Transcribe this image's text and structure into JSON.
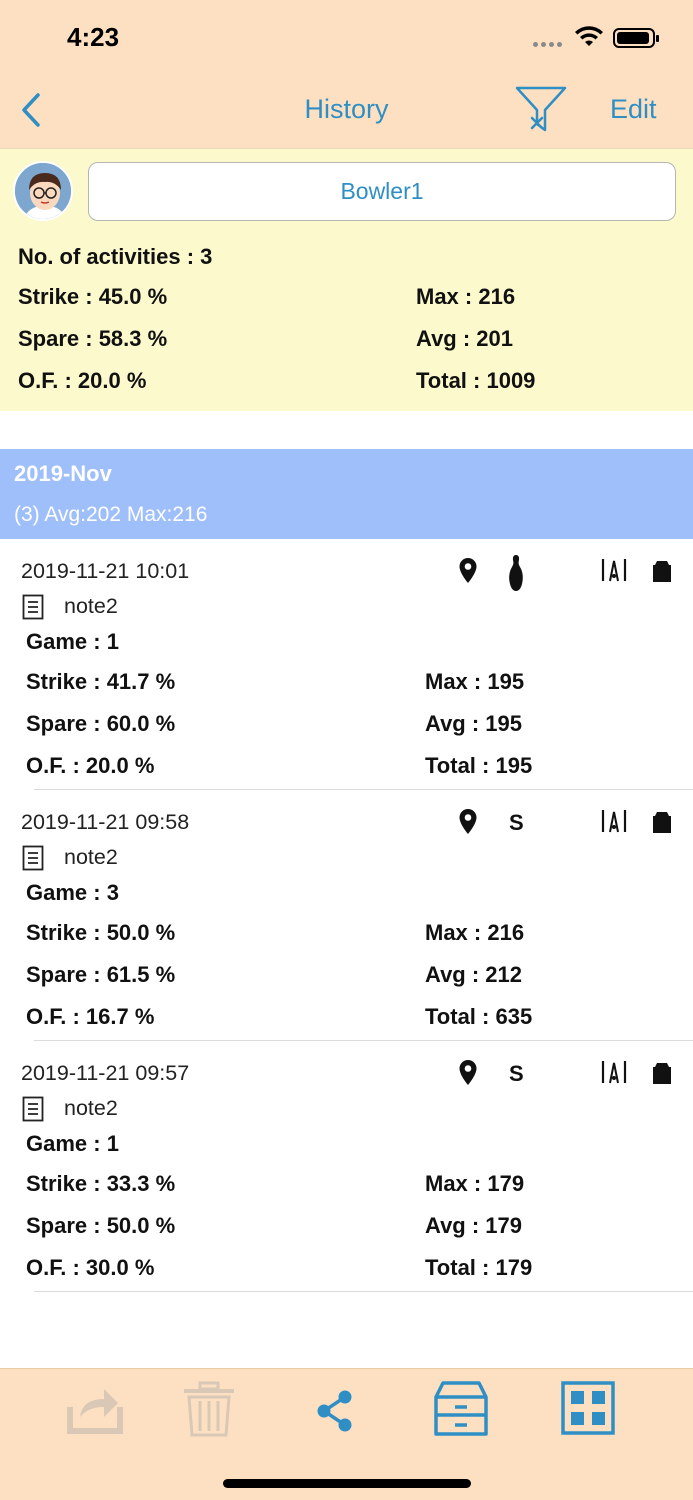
{
  "status_bar": {
    "time": "4:23"
  },
  "nav": {
    "title": "History",
    "edit_label": "Edit"
  },
  "summary": {
    "bowler_name": "Bowler1",
    "activities": "No. of activities : 3",
    "strike": "Strike : 45.0 %",
    "spare": "Spare : 58.3 %",
    "of": "O.F. : 20.0 %",
    "max": "Max : 216",
    "avg": "Avg : 201",
    "total": "Total : 1009"
  },
  "section": {
    "title": "2019-Nov",
    "subtitle": "(3)  Avg:202  Max:216"
  },
  "entries": [
    {
      "date": "2019-11-21 10:01",
      "note": "note2",
      "type_icon": "bowling-pin-icon",
      "game": "Game : 1",
      "strike": "Strike : 41.7 %",
      "spare": "Spare : 60.0 %",
      "of": "O.F. : 20.0 %",
      "max": "Max : 195",
      "avg": "Avg : 195",
      "total": "Total : 195"
    },
    {
      "date": "2019-11-21 09:58",
      "note": "note2",
      "type_icon": "s-icon",
      "type_label": "S",
      "game": "Game : 3",
      "strike": "Strike : 50.0 %",
      "spare": "Spare : 61.5 %",
      "of": "O.F. : 16.7 %",
      "max": "Max : 216",
      "avg": "Avg : 212",
      "total": "Total : 635"
    },
    {
      "date": "2019-11-21 09:57",
      "note": "note2",
      "type_icon": "s-icon",
      "type_label": "S",
      "game": "Game : 1",
      "strike": "Strike : 33.3 %",
      "spare": "Spare : 50.0 %",
      "of": "O.F. : 30.0 %",
      "max": "Max : 179",
      "avg": "Avg : 179",
      "total": "Total : 179"
    }
  ],
  "toolbar": {
    "items": [
      "export-icon",
      "trash-icon",
      "share-icon",
      "cabinet-icon",
      "grid-icon"
    ]
  },
  "colors": {
    "header_bg": "#fde0c2",
    "summary_bg": "#fcf9cd",
    "section_bg": "#9fbffb",
    "accent": "#2f8fc4"
  }
}
